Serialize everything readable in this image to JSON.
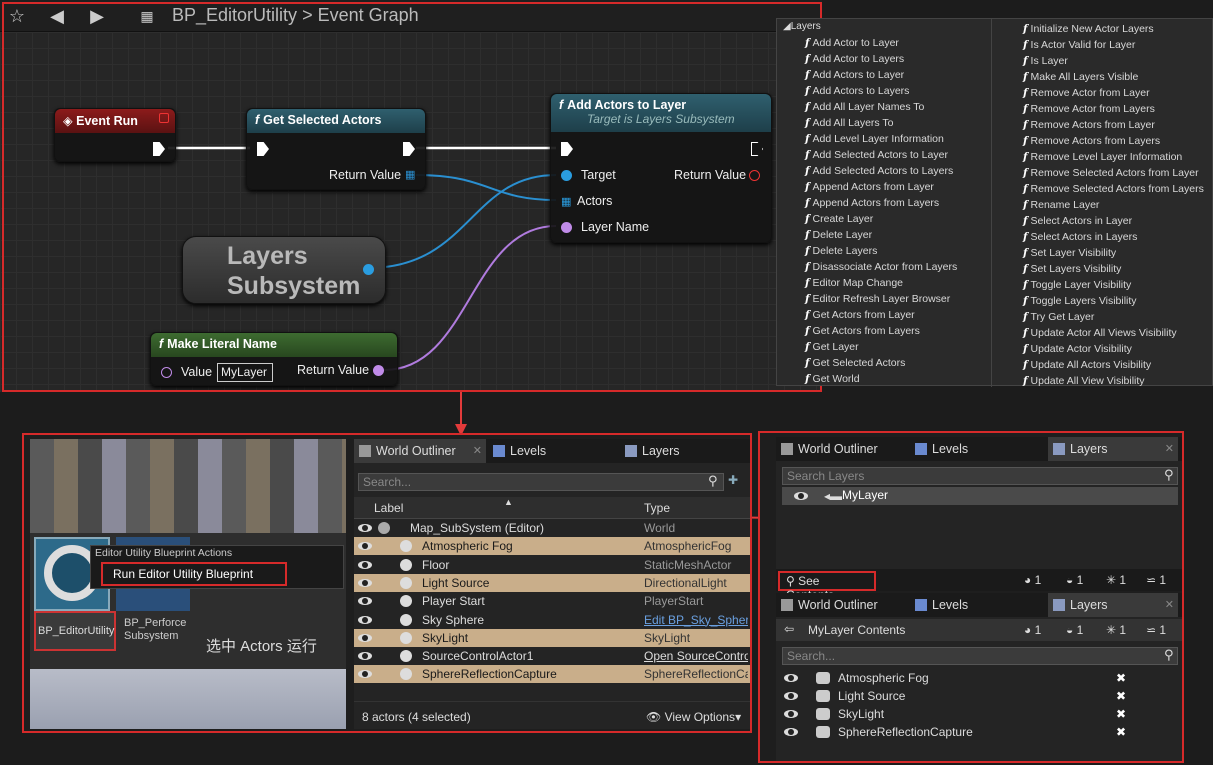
{
  "graph": {
    "breadcrumb_asset": "BP_EditorUtility",
    "breadcrumb_sep": ">",
    "breadcrumb_graph": "Event Graph"
  },
  "nodes": {
    "event_run": {
      "title": "Event Run"
    },
    "get_selected": {
      "title": "Get Selected Actors",
      "return": "Return Value"
    },
    "add_actors": {
      "title": "Add Actors to Layer",
      "subtitle": "Target is Layers Subsystem",
      "target": "Target",
      "actors": "Actors",
      "layer_name": "Layer Name",
      "return": "Return Value"
    },
    "layers_subsystem": {
      "line1": "Layers",
      "line2": "Subsystem"
    },
    "make_literal": {
      "title": "Make Literal Name",
      "value_label": "Value",
      "value": "MyLayer",
      "return": "Return Value"
    }
  },
  "menu": {
    "category": "Layers",
    "col1": [
      "Add Actor to Layer",
      "Add Actor to Layers",
      "Add Actors to Layer",
      "Add Actors to Layers",
      "Add All Layer Names To",
      "Add All Layers To",
      "Add Level Layer Information",
      "Add Selected Actors to Layer",
      "Add Selected Actors to Layers",
      "Append Actors from Layer",
      "Append Actors from Layers",
      "Create Layer",
      "Delete Layer",
      "Delete Layers",
      "Disassociate Actor from Layers",
      "Editor Map Change",
      "Editor Refresh Layer Browser",
      "Get Actors from Layer",
      "Get Actors from Layers",
      "Get Layer",
      "Get Selected Actors",
      "Get World"
    ],
    "col2": [
      "Initialize New Actor Layers",
      "Is Actor Valid for Layer",
      "Is Layer",
      "Make All Layers Visible",
      "Remove Actor from Layer",
      "Remove Actor from Layers",
      "Remove Actors from Layer",
      "Remove Actors from Layers",
      "Remove Level Layer Information",
      "Remove Selected Actors from Layer",
      "Remove Selected Actors from Layers",
      "Rename Layer",
      "Select Actors in Layer",
      "Select Actors in Layers",
      "Set Layer Visibility",
      "Set Layers Visibility",
      "Toggle Layer Visibility",
      "Toggle Layers Visibility",
      "Try Get Layer",
      "Update Actor All Views Visibility",
      "Update Actor Visibility",
      "Update All Actors Visibility",
      "Update All View Visibility"
    ]
  },
  "content_browser": {
    "context_title": "Editor Utility Blueprint Actions",
    "run_item": "Run Editor Utility Blueprint",
    "asset1": "BP_EditorUtility",
    "asset2_line1": "BP_Perforce",
    "asset2_line2": "Subsystem",
    "annotation": "选中 Actors 运行"
  },
  "outliner": {
    "tabs": [
      "World Outliner",
      "Levels",
      "Layers"
    ],
    "search_placeholder": "Search...",
    "col_label": "Label",
    "col_type": "Type",
    "rows": [
      {
        "label": "Map_SubSystem (Editor)",
        "type": "World"
      },
      {
        "label": "Atmospheric Fog",
        "type": "AtmosphericFog"
      },
      {
        "label": "Floor",
        "type": "StaticMeshActor"
      },
      {
        "label": "Light Source",
        "type": "DirectionalLight"
      },
      {
        "label": "Player Start",
        "type": "PlayerStart"
      },
      {
        "label": "Sky Sphere",
        "type": "Edit BP_Sky_Sphere"
      },
      {
        "label": "SkyLight",
        "type": "SkyLight"
      },
      {
        "label": "SourceControlActor1",
        "type": "Open SourceControlActor"
      },
      {
        "label": "SphereReflectionCapture",
        "type": "SphereReflectionCapture"
      }
    ],
    "status": "8 actors (4 selected)",
    "view_options": "View Options"
  },
  "layers_top": {
    "tabs": [
      "World Outliner",
      "Levels",
      "Layers"
    ],
    "search_placeholder": "Search Layers",
    "layer": "MyLayer",
    "see_contents": "See Contents",
    "stats": [
      "1",
      "1",
      "1",
      "1"
    ]
  },
  "layers_bottom": {
    "tabs": [
      "World Outliner",
      "Levels",
      "Layers"
    ],
    "header": "MyLayer Contents",
    "stats": [
      "1",
      "1",
      "1",
      "1"
    ],
    "search_placeholder": "Search...",
    "items": [
      "Atmospheric Fog",
      "Light Source",
      "SkyLight",
      "SphereReflectionCapture"
    ]
  }
}
